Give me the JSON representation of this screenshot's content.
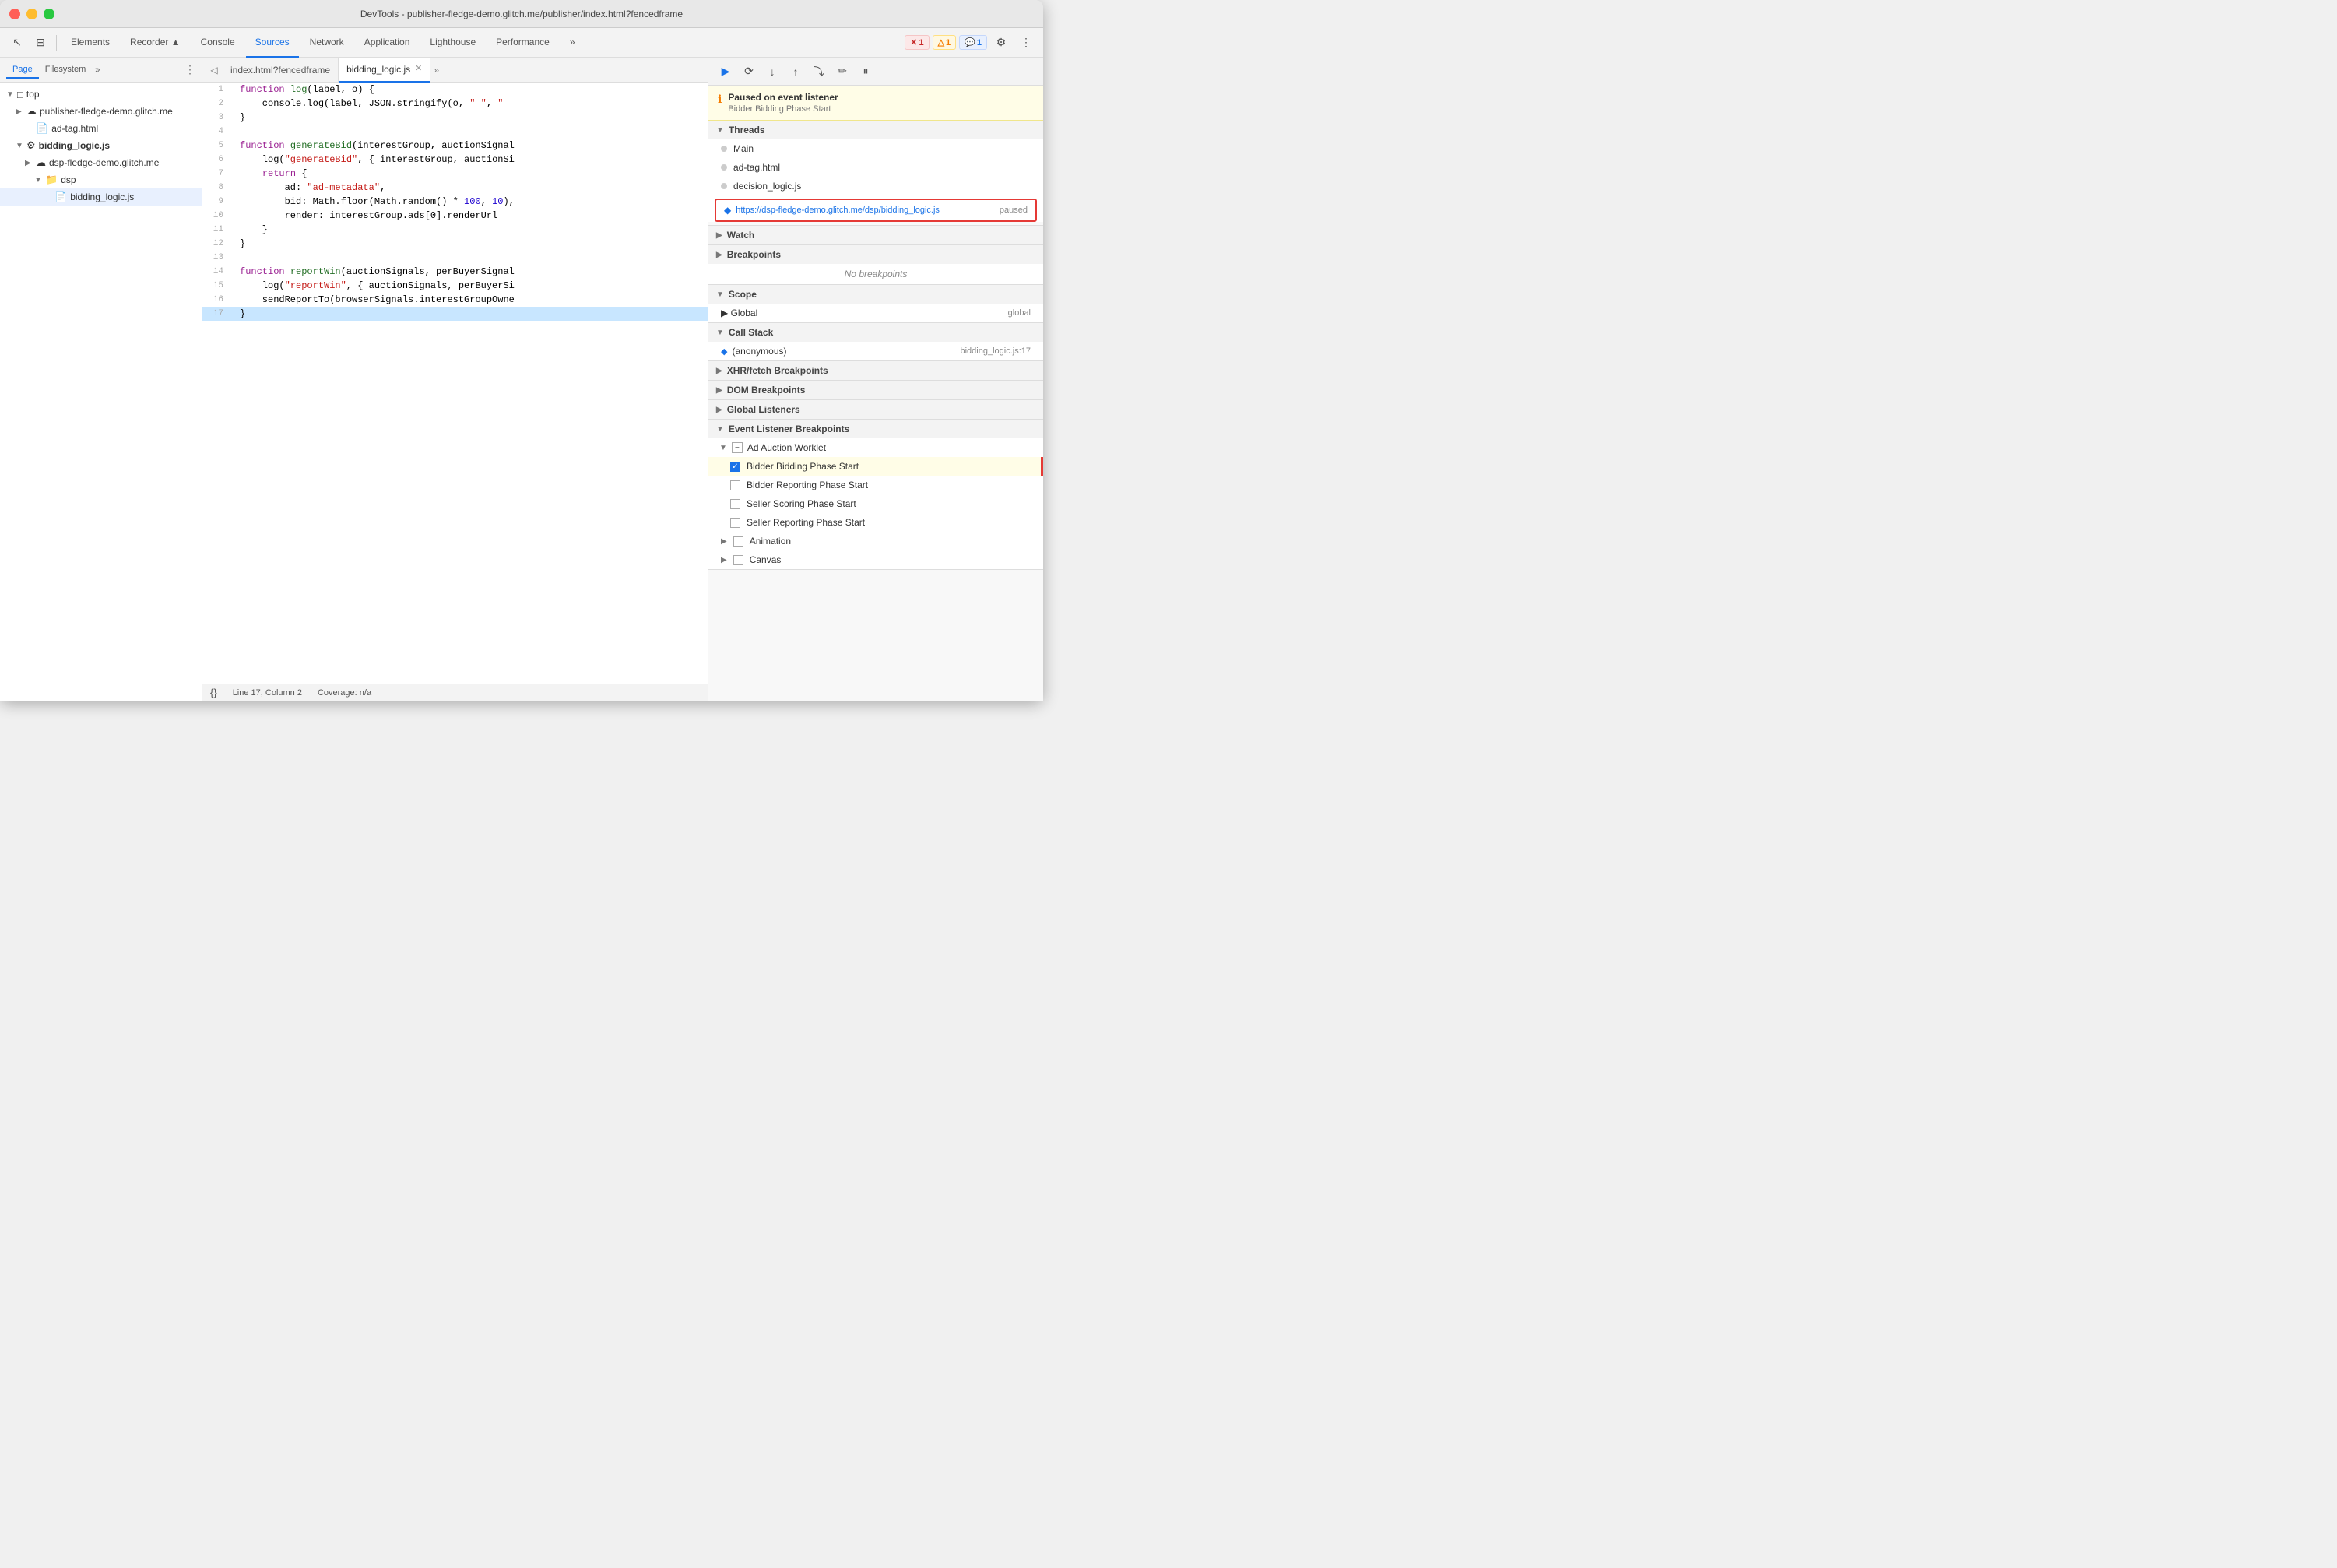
{
  "titlebar": {
    "text": "DevTools - publisher-fledge-demo.glitch.me/publisher/index.html?fencedframe"
  },
  "toolbar": {
    "tabs": [
      {
        "label": "Elements",
        "active": false
      },
      {
        "label": "Recorder ▲",
        "active": false
      },
      {
        "label": "Console",
        "active": false
      },
      {
        "label": "Sources",
        "active": true
      },
      {
        "label": "Network",
        "active": false
      },
      {
        "label": "Application",
        "active": false
      },
      {
        "label": "Lighthouse",
        "active": false
      },
      {
        "label": "Performance",
        "active": false
      }
    ],
    "more_label": "»",
    "badges": {
      "error": {
        "count": "1",
        "icon": "✕"
      },
      "warn": {
        "count": "1",
        "icon": "△"
      },
      "info": {
        "count": "1",
        "icon": "💬"
      }
    }
  },
  "file_tree": {
    "page_tab": "Page",
    "filesystem_tab": "Filesystem",
    "more_tab": "»",
    "items": [
      {
        "label": "top",
        "indent": 0,
        "type": "arrow-down",
        "icon": "□"
      },
      {
        "label": "publisher-fledge-demo.glitch.me",
        "indent": 1,
        "type": "arrow-right",
        "icon": "☁"
      },
      {
        "label": "ad-tag.html",
        "indent": 2,
        "type": "none",
        "icon": "📄"
      },
      {
        "label": "bidding_logic.js",
        "indent": 1,
        "type": "arrow-down",
        "icon": "⚙",
        "selected": false,
        "bold": true
      },
      {
        "label": "dsp-fledge-demo.glitch.me",
        "indent": 2,
        "type": "arrow-right",
        "icon": "☁"
      },
      {
        "label": "dsp",
        "indent": 3,
        "type": "arrow-down",
        "icon": "📁"
      },
      {
        "label": "bidding_logic.js",
        "indent": 4,
        "type": "none",
        "icon": "📄",
        "selected": true
      }
    ]
  },
  "code_editor": {
    "tabs": [
      {
        "label": "index.html?fencedframe",
        "active": false,
        "closeable": false
      },
      {
        "label": "bidding_logic.js",
        "active": true,
        "closeable": true
      }
    ],
    "more_label": "»",
    "lines": [
      {
        "num": 1,
        "code": "function log(label, o) {",
        "highlighted": false
      },
      {
        "num": 2,
        "code": "    console.log(label, JSON.stringify(o, \" \", \"",
        "highlighted": false
      },
      {
        "num": 3,
        "code": "}",
        "highlighted": false
      },
      {
        "num": 4,
        "code": "",
        "highlighted": false
      },
      {
        "num": 5,
        "code": "function generateBid(interestGroup, auctionSignal",
        "highlighted": false
      },
      {
        "num": 6,
        "code": "    log(\"generateBid\", { interestGroup, auctionSi",
        "highlighted": false
      },
      {
        "num": 7,
        "code": "    return {",
        "highlighted": false
      },
      {
        "num": 8,
        "code": "        ad: \"ad-metadata\",",
        "highlighted": false
      },
      {
        "num": 9,
        "code": "        bid: Math.floor(Math.random() * 100, 10),",
        "highlighted": false
      },
      {
        "num": 10,
        "code": "        render: interestGroup.ads[0].renderUrl",
        "highlighted": false
      },
      {
        "num": 11,
        "code": "    }",
        "highlighted": false
      },
      {
        "num": 12,
        "code": "}",
        "highlighted": false
      },
      {
        "num": 13,
        "code": "",
        "highlighted": false
      },
      {
        "num": 14,
        "code": "function reportWin(auctionSignals, perBuyerSignal",
        "highlighted": false
      },
      {
        "num": 15,
        "code": "    log(\"reportWin\", { auctionSignals, perBuyerSi",
        "highlighted": false
      },
      {
        "num": 16,
        "code": "    sendReportTo(browserSignals.interestGroupOwne",
        "highlighted": false
      },
      {
        "num": 17,
        "code": "}",
        "highlighted": true
      }
    ],
    "statusbar": {
      "format_icon": "{}",
      "line_col": "Line 17, Column 2",
      "coverage": "Coverage: n/a"
    }
  },
  "debug_panel": {
    "toolbar_buttons": [
      "▶",
      "⟳",
      "↓",
      "↑",
      "⤵",
      "✏",
      "⏸"
    ],
    "paused_banner": {
      "icon": "ℹ",
      "title": "Paused on event listener",
      "subtitle": "Bidder Bidding Phase Start"
    },
    "threads": {
      "section_label": "Threads",
      "items": [
        {
          "label": "Main",
          "active": false
        },
        {
          "label": "ad-tag.html",
          "active": false
        },
        {
          "label": "decision_logic.js",
          "active": false
        }
      ],
      "selected_thread": {
        "url": "https://dsp-fledge-demo.glitch.me/dsp/bidding_logic.js",
        "status": "paused"
      }
    },
    "watch": {
      "section_label": "Watch"
    },
    "breakpoints": {
      "section_label": "Breakpoints",
      "empty_message": "No breakpoints"
    },
    "scope": {
      "section_label": "Scope",
      "items": [
        {
          "label": "▶ Global",
          "value": "global"
        }
      ]
    },
    "call_stack": {
      "section_label": "Call Stack",
      "items": [
        {
          "arrow": "◆",
          "label": "(anonymous)",
          "location": "bidding_logic.js:17"
        }
      ]
    },
    "xhr_fetch": {
      "section_label": "XHR/fetch Breakpoints"
    },
    "dom_breakpoints": {
      "section_label": "DOM Breakpoints"
    },
    "global_listeners": {
      "section_label": "Global Listeners"
    },
    "event_listener_breakpoints": {
      "section_label": "Event Listener Breakpoints",
      "worklets": {
        "label": "Ad Auction Worklet",
        "items": [
          {
            "label": "Bidder Bidding Phase Start",
            "checked": true,
            "highlighted": true
          },
          {
            "label": "Bidder Reporting Phase Start",
            "checked": false,
            "highlighted": false
          },
          {
            "label": "Seller Scoring Phase Start",
            "checked": false,
            "highlighted": false
          },
          {
            "label": "Seller Reporting Phase Start",
            "checked": false,
            "highlighted": false
          }
        ]
      },
      "animation": {
        "label": "Animation",
        "checked": false
      },
      "canvas": {
        "label": "Canvas",
        "checked": false
      }
    }
  }
}
